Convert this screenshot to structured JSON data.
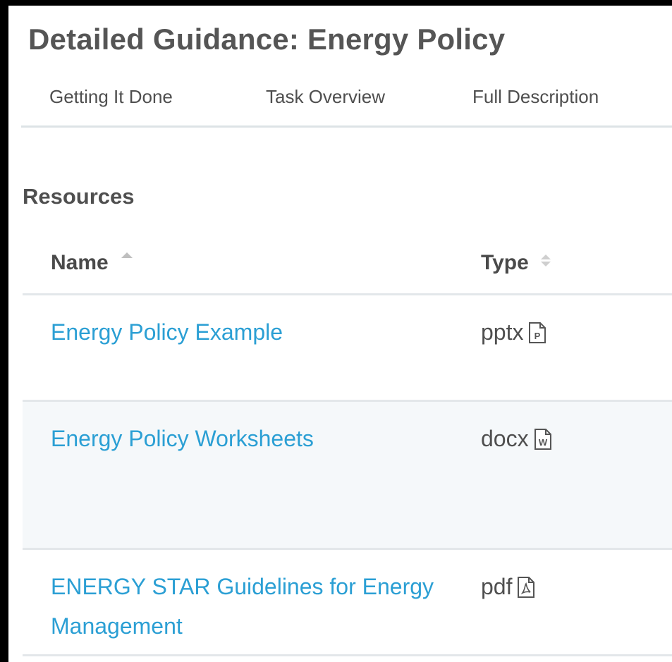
{
  "page": {
    "title": "Detailed Guidance: Energy Policy"
  },
  "tabs": [
    {
      "label": "Getting It Done"
    },
    {
      "label": "Task Overview"
    },
    {
      "label": "Full Description"
    }
  ],
  "resources": {
    "heading": "Resources",
    "columns": {
      "name": "Name",
      "type": "Type"
    },
    "rows": [
      {
        "name": "Energy Policy Example",
        "type": "pptx",
        "icon": "pptx-file-icon"
      },
      {
        "name": "Energy Policy Worksheets",
        "type": "docx",
        "icon": "docx-file-icon"
      },
      {
        "name": "ENERGY STAR Guidelines for Energy Management",
        "type": "pdf",
        "icon": "pdf-file-icon"
      }
    ]
  },
  "colors": {
    "link": "#2b9fd4",
    "text": "#4f4f4f",
    "row_alt": "#f5f8fa",
    "divider": "#e3e7ea"
  }
}
